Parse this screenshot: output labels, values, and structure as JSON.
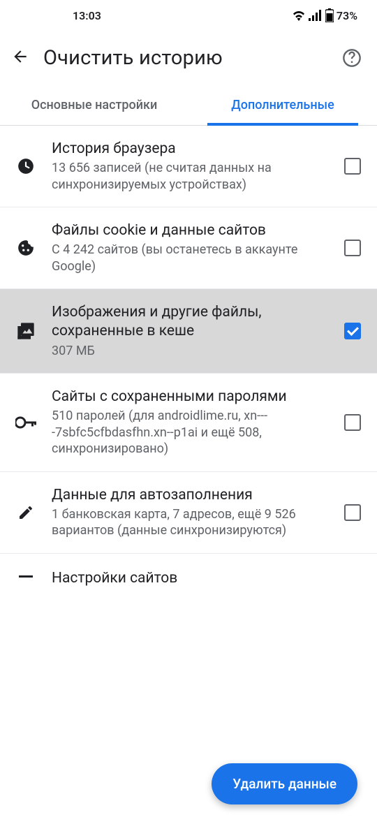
{
  "status": {
    "time": "13:03",
    "battery": "73%"
  },
  "header": {
    "title": "Очистить историю"
  },
  "tabs": {
    "basic": "Основные настройки",
    "advanced": "Дополнительные"
  },
  "rows": {
    "history": {
      "title": "История браузера",
      "sub": "13 656 записей (не считая данных на синхронизируемых устройствах)"
    },
    "cookies": {
      "title": "Файлы cookie и данные сайтов",
      "sub": "С 4 242 сайтов (вы останетесь в аккаунте Google)"
    },
    "cache": {
      "title": "Изображения и другие файлы, сохраненные в кеше",
      "sub": "307 МБ"
    },
    "passwords": {
      "title": "Сайты с сохраненными паролями",
      "sub": "510 паролей (для androidlime.ru, xn----7sbfc5cfbdasfhn.xn--p1ai и ещё 508, синхронизировано)"
    },
    "autofill": {
      "title": "Данные для автозаполнения",
      "sub": "1 банковская карта, 7 адресов, ещё 9 526 вариантов (данные синхронизируются)"
    },
    "sites": {
      "title": "Настройки сайтов"
    }
  },
  "fab": "Удалить данные"
}
